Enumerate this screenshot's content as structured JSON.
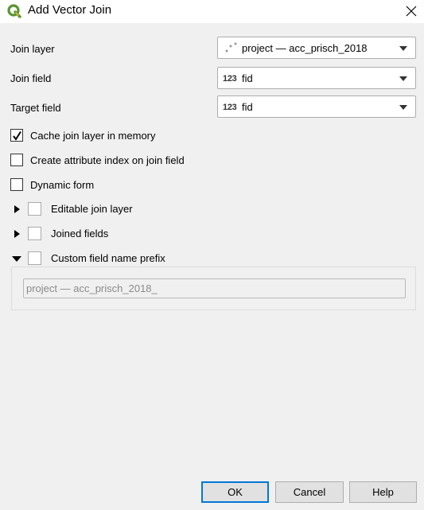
{
  "window": {
    "title": "Add Vector Join",
    "icon": "qgis-logo-icon",
    "close_icon": "close-icon"
  },
  "form": {
    "join_layer": {
      "label": "Join layer",
      "value": "project — acc_prisch_2018",
      "icon": "point-layer-icon"
    },
    "join_field": {
      "label": "Join field",
      "value": "fid",
      "type_icon": "123"
    },
    "target_field": {
      "label": "Target field",
      "value": "fid",
      "type_icon": "123"
    }
  },
  "checkboxes": {
    "cache": {
      "label": "Cache join layer in memory",
      "checked": true
    },
    "attribute_index": {
      "label": "Create attribute index on join field",
      "checked": false
    },
    "dynamic_form": {
      "label": "Dynamic form",
      "checked": false
    }
  },
  "groups": {
    "editable": {
      "label": "Editable join layer",
      "expanded": false,
      "checked": false
    },
    "joined_fields": {
      "label": "Joined fields",
      "expanded": false,
      "checked": false
    },
    "prefix": {
      "label": "Custom field name prefix",
      "expanded": true,
      "checked": false,
      "value": "project — acc_prisch_2018_"
    }
  },
  "buttons": {
    "ok": "OK",
    "cancel": "Cancel",
    "help": "Help"
  },
  "colors": {
    "accent": "#0078d7",
    "qgis_green": "#589632",
    "qgis_yellow": "#f0b22b"
  }
}
